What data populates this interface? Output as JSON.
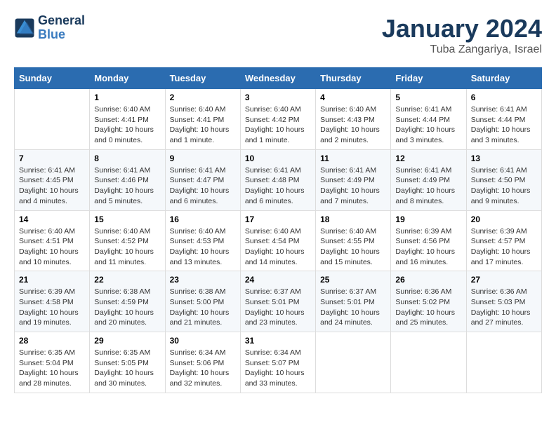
{
  "header": {
    "logo_line1": "General",
    "logo_line2": "Blue",
    "month_title": "January 2024",
    "location": "Tuba Zangariya, Israel"
  },
  "days_of_week": [
    "Sunday",
    "Monday",
    "Tuesday",
    "Wednesday",
    "Thursday",
    "Friday",
    "Saturday"
  ],
  "weeks": [
    [
      {
        "day": "",
        "info": ""
      },
      {
        "day": "1",
        "info": "Sunrise: 6:40 AM\nSunset: 4:41 PM\nDaylight: 10 hours\nand 0 minutes."
      },
      {
        "day": "2",
        "info": "Sunrise: 6:40 AM\nSunset: 4:41 PM\nDaylight: 10 hours\nand 1 minute."
      },
      {
        "day": "3",
        "info": "Sunrise: 6:40 AM\nSunset: 4:42 PM\nDaylight: 10 hours\nand 1 minute."
      },
      {
        "day": "4",
        "info": "Sunrise: 6:40 AM\nSunset: 4:43 PM\nDaylight: 10 hours\nand 2 minutes."
      },
      {
        "day": "5",
        "info": "Sunrise: 6:41 AM\nSunset: 4:44 PM\nDaylight: 10 hours\nand 3 minutes."
      },
      {
        "day": "6",
        "info": "Sunrise: 6:41 AM\nSunset: 4:44 PM\nDaylight: 10 hours\nand 3 minutes."
      }
    ],
    [
      {
        "day": "7",
        "info": "Sunrise: 6:41 AM\nSunset: 4:45 PM\nDaylight: 10 hours\nand 4 minutes."
      },
      {
        "day": "8",
        "info": "Sunrise: 6:41 AM\nSunset: 4:46 PM\nDaylight: 10 hours\nand 5 minutes."
      },
      {
        "day": "9",
        "info": "Sunrise: 6:41 AM\nSunset: 4:47 PM\nDaylight: 10 hours\nand 6 minutes."
      },
      {
        "day": "10",
        "info": "Sunrise: 6:41 AM\nSunset: 4:48 PM\nDaylight: 10 hours\nand 6 minutes."
      },
      {
        "day": "11",
        "info": "Sunrise: 6:41 AM\nSunset: 4:49 PM\nDaylight: 10 hours\nand 7 minutes."
      },
      {
        "day": "12",
        "info": "Sunrise: 6:41 AM\nSunset: 4:49 PM\nDaylight: 10 hours\nand 8 minutes."
      },
      {
        "day": "13",
        "info": "Sunrise: 6:41 AM\nSunset: 4:50 PM\nDaylight: 10 hours\nand 9 minutes."
      }
    ],
    [
      {
        "day": "14",
        "info": "Sunrise: 6:40 AM\nSunset: 4:51 PM\nDaylight: 10 hours\nand 10 minutes."
      },
      {
        "day": "15",
        "info": "Sunrise: 6:40 AM\nSunset: 4:52 PM\nDaylight: 10 hours\nand 11 minutes."
      },
      {
        "day": "16",
        "info": "Sunrise: 6:40 AM\nSunset: 4:53 PM\nDaylight: 10 hours\nand 13 minutes."
      },
      {
        "day": "17",
        "info": "Sunrise: 6:40 AM\nSunset: 4:54 PM\nDaylight: 10 hours\nand 14 minutes."
      },
      {
        "day": "18",
        "info": "Sunrise: 6:40 AM\nSunset: 4:55 PM\nDaylight: 10 hours\nand 15 minutes."
      },
      {
        "day": "19",
        "info": "Sunrise: 6:39 AM\nSunset: 4:56 PM\nDaylight: 10 hours\nand 16 minutes."
      },
      {
        "day": "20",
        "info": "Sunrise: 6:39 AM\nSunset: 4:57 PM\nDaylight: 10 hours\nand 17 minutes."
      }
    ],
    [
      {
        "day": "21",
        "info": "Sunrise: 6:39 AM\nSunset: 4:58 PM\nDaylight: 10 hours\nand 19 minutes."
      },
      {
        "day": "22",
        "info": "Sunrise: 6:38 AM\nSunset: 4:59 PM\nDaylight: 10 hours\nand 20 minutes."
      },
      {
        "day": "23",
        "info": "Sunrise: 6:38 AM\nSunset: 5:00 PM\nDaylight: 10 hours\nand 21 minutes."
      },
      {
        "day": "24",
        "info": "Sunrise: 6:37 AM\nSunset: 5:01 PM\nDaylight: 10 hours\nand 23 minutes."
      },
      {
        "day": "25",
        "info": "Sunrise: 6:37 AM\nSunset: 5:01 PM\nDaylight: 10 hours\nand 24 minutes."
      },
      {
        "day": "26",
        "info": "Sunrise: 6:36 AM\nSunset: 5:02 PM\nDaylight: 10 hours\nand 25 minutes."
      },
      {
        "day": "27",
        "info": "Sunrise: 6:36 AM\nSunset: 5:03 PM\nDaylight: 10 hours\nand 27 minutes."
      }
    ],
    [
      {
        "day": "28",
        "info": "Sunrise: 6:35 AM\nSunset: 5:04 PM\nDaylight: 10 hours\nand 28 minutes."
      },
      {
        "day": "29",
        "info": "Sunrise: 6:35 AM\nSunset: 5:05 PM\nDaylight: 10 hours\nand 30 minutes."
      },
      {
        "day": "30",
        "info": "Sunrise: 6:34 AM\nSunset: 5:06 PM\nDaylight: 10 hours\nand 32 minutes."
      },
      {
        "day": "31",
        "info": "Sunrise: 6:34 AM\nSunset: 5:07 PM\nDaylight: 10 hours\nand 33 minutes."
      },
      {
        "day": "",
        "info": ""
      },
      {
        "day": "",
        "info": ""
      },
      {
        "day": "",
        "info": ""
      }
    ]
  ]
}
